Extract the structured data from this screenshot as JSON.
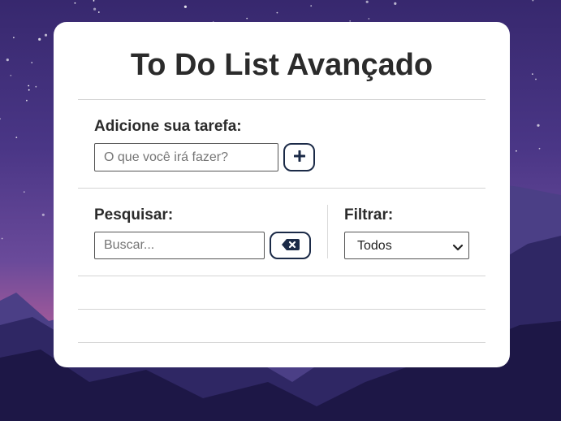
{
  "app": {
    "title": "To Do List Avançado"
  },
  "add_section": {
    "label": "Adicione sua tarefa:",
    "input_placeholder": "O que você irá fazer?",
    "input_value": "",
    "add_button_icon": "plus-icon"
  },
  "search_section": {
    "label": "Pesquisar:",
    "input_placeholder": "Buscar...",
    "input_value": "",
    "clear_button_icon": "backspace-clear-icon"
  },
  "filter_section": {
    "label": "Filtrar:",
    "selected": "Todos",
    "dropdown_icon": "chevron-down-icon"
  },
  "todo_list": {
    "items": []
  },
  "colors": {
    "accent": "#1b2a47",
    "title_text": "#2b2b2b",
    "card_background": "#ffffff",
    "sky_top": "#3d2c78",
    "sky_bottom": "#a35a9a"
  }
}
